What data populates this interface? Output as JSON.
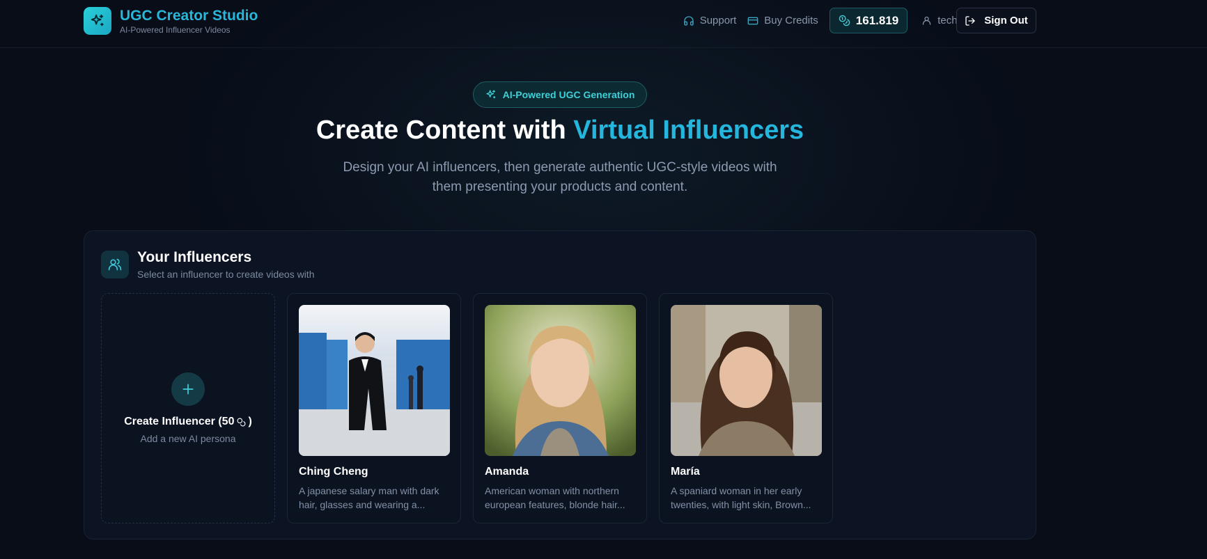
{
  "header": {
    "brand_title": "UGC Creator Studio",
    "brand_subtitle": "AI-Powered Influencer Videos",
    "nav": {
      "support": "Support",
      "buy_credits": "Buy Credits"
    },
    "credits": "161.819",
    "user": "technologyanimatio...",
    "sign_out": "Sign Out"
  },
  "hero": {
    "badge": "AI-Powered UGC Generation",
    "title_prefix": "Create Content with ",
    "title_accent": "Virtual Influencers",
    "description": "Design your AI influencers, then generate authentic UGC-style videos with them presenting your products and content."
  },
  "influencers_panel": {
    "title": "Your Influencers",
    "subtitle": "Select an influencer to create videos with",
    "create_card": {
      "title_prefix": "Create Influencer (50",
      "title_suffix": ")",
      "subtitle": "Add a new AI persona"
    },
    "items": [
      {
        "name": "Ching Cheng",
        "description": "A japanese salary man with dark hair, glasses and wearing a..."
      },
      {
        "name": "Amanda",
        "description": "American woman with northern european features, blonde hair..."
      },
      {
        "name": "María",
        "description": "A spaniard woman in her early twenties, with light skin, Brown..."
      }
    ]
  },
  "icons": {
    "brand": "sparkles-icon",
    "support": "headphones-icon",
    "buy_credits": "credit-card-icon",
    "credits": "coins-icon",
    "user": "user-icon",
    "sign_out": "log-out-icon",
    "badge": "sparkles-icon",
    "panel": "users-icon",
    "create": "plus-icon"
  },
  "colors": {
    "accent": "#24b6dd",
    "teal": "#3fd0d8",
    "background": "#080d18"
  }
}
